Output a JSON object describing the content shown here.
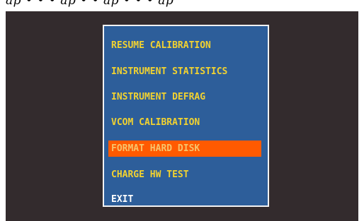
{
  "header_caption": "ap • • • ap • • ap • • • ap",
  "menu": {
    "items": [
      {
        "label": "RESUME CALIBRATION"
      },
      {
        "label": "INSTRUMENT STATISTICS"
      },
      {
        "label": "INSTRUMENT DEFRAG"
      },
      {
        "label": "VCOM CALIBRATION"
      },
      {
        "label": "FORMAT HARD DISK",
        "selected": true
      },
      {
        "label": "CHARGE HW TEST"
      },
      {
        "label": "EXIT"
      }
    ]
  },
  "colors": {
    "screen_background": "#332b2d",
    "panel_background": "#2d5e9a",
    "panel_border": "#f2f2f2",
    "item_text": "#f2d230",
    "selected_background": "#ff5a00",
    "selected_text": "#f8c36a",
    "exit_text": "#ffffff"
  }
}
